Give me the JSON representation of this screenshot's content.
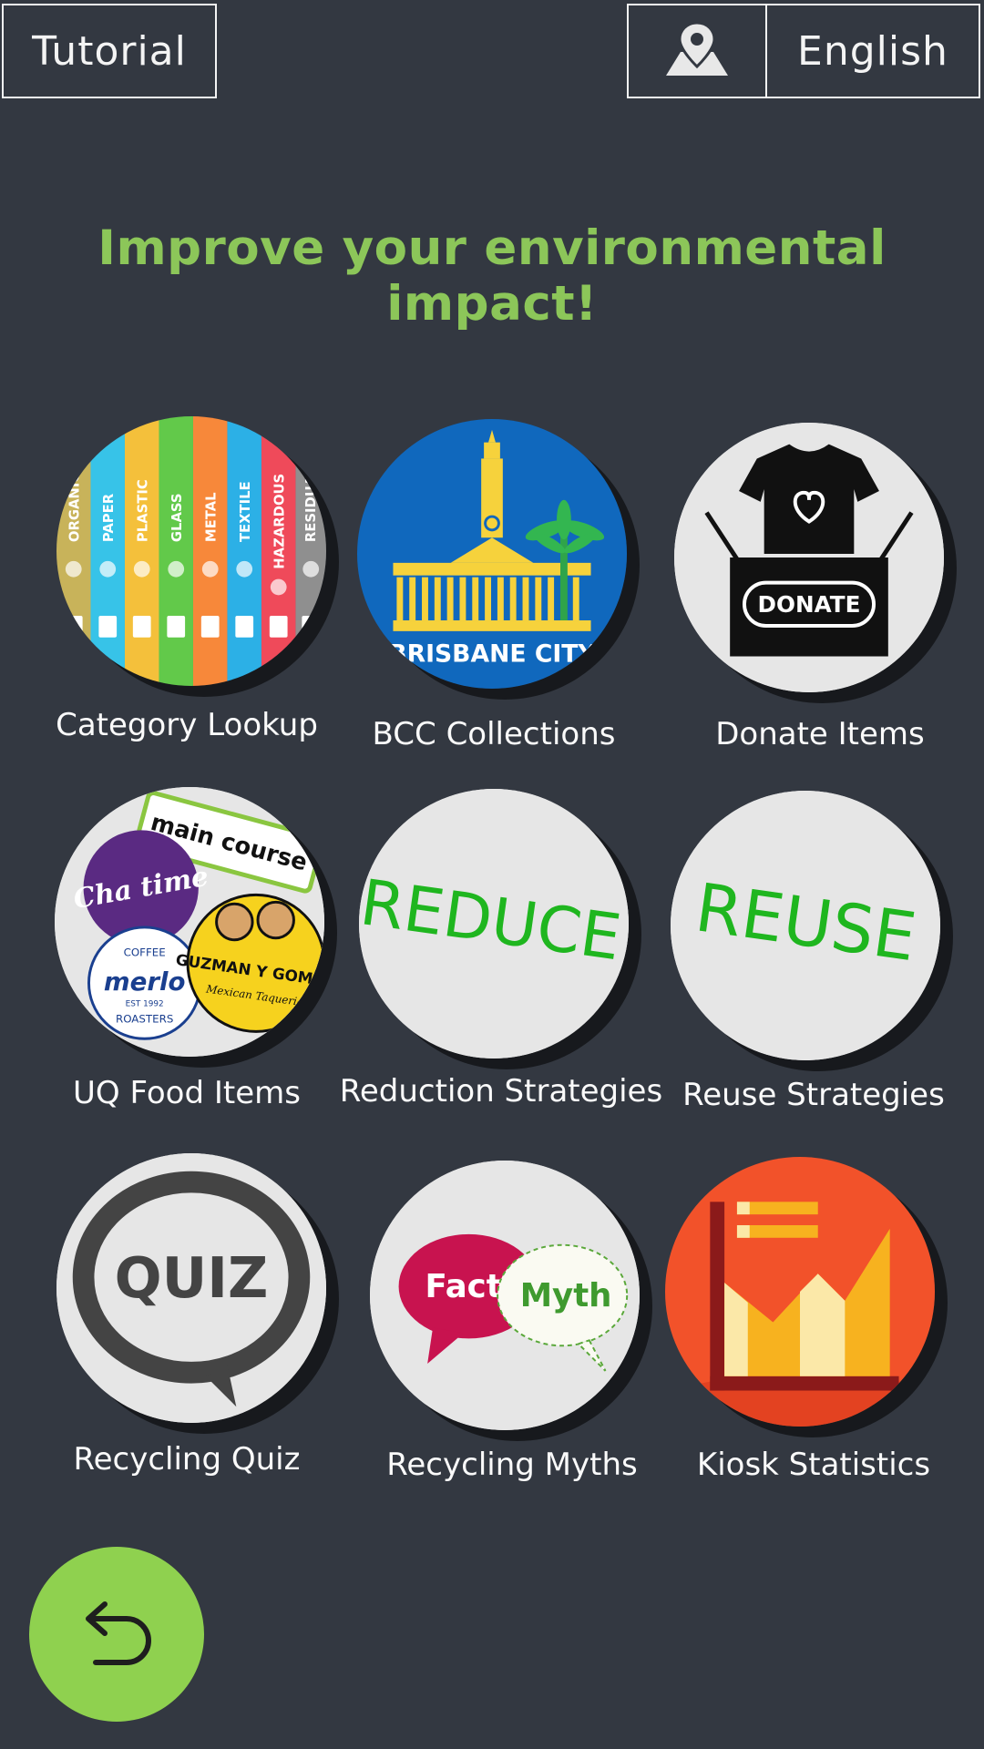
{
  "header": {
    "tutorial_label": "Tutorial",
    "language_label": "English",
    "location_icon": "map-pin-icon"
  },
  "headline": "Improve your environmental impact!",
  "tiles": [
    {
      "label": "Category Lookup",
      "icon": "recycling-categories-icon",
      "stripes": [
        "ORGANIC",
        "PAPER",
        "PLASTIC",
        "GLASS",
        "METAL",
        "TEXTILE",
        "HAZARDOUS",
        "RESIDUAL"
      ]
    },
    {
      "label": "BCC Collections",
      "icon": "brisbane-city-logo",
      "logo_text": "BRISBANE CITY"
    },
    {
      "label": "Donate Items",
      "icon": "donate-box-icon",
      "logo_text": "DONATE"
    },
    {
      "label": "UQ Food Items",
      "icon": "food-vendors-icon",
      "logos": [
        "main course",
        "Cha time",
        "merlo",
        "COFFEE",
        "ROASTERS",
        "EST 1992",
        "GUZMAN Y GOMEZ",
        "Mexican Taqueria"
      ]
    },
    {
      "label": "Reduction Strategies",
      "icon": "reduce-icon",
      "logo_text": "REDUCE"
    },
    {
      "label": "Reuse Strategies",
      "icon": "reuse-icon",
      "logo_text": "REUSE"
    },
    {
      "label": "Recycling Quiz",
      "icon": "quiz-bubble-icon",
      "logo_text": "QUIZ"
    },
    {
      "label": "Recycling Myths",
      "icon": "fact-myth-icon",
      "logo_fact": "Fact",
      "logo_myth": "Myth"
    },
    {
      "label": "Kiosk Statistics",
      "icon": "statistics-chart-icon"
    }
  ],
  "back_button": {
    "icon": "back-arrow-icon"
  },
  "colors": {
    "background": "#333841",
    "accent_green": "#8cc659",
    "back_button": "#8fd14f"
  }
}
